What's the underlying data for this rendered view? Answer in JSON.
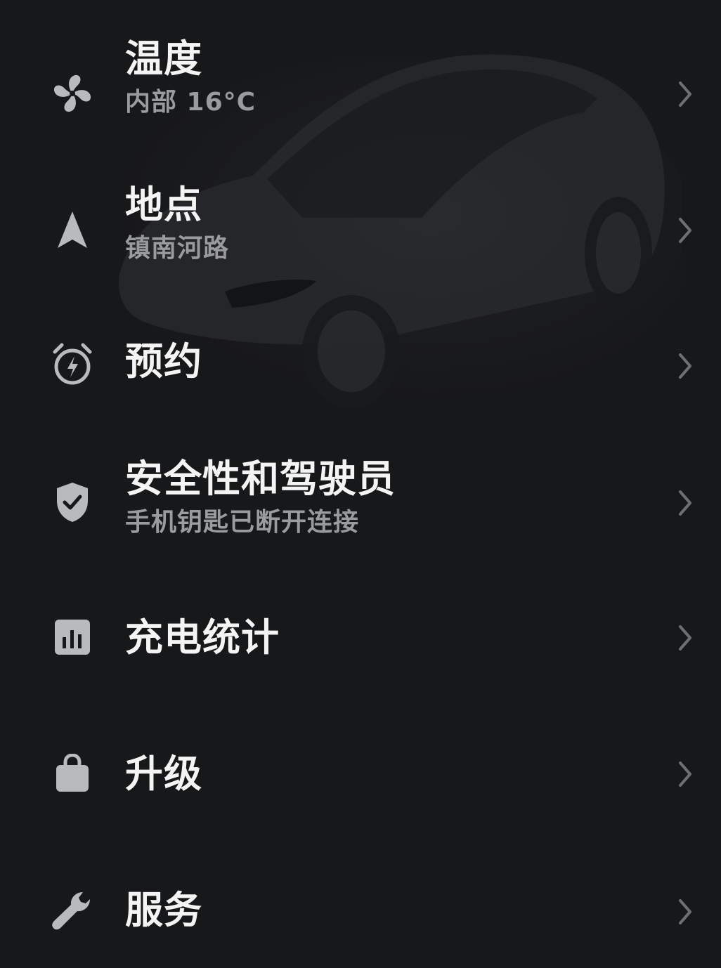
{
  "menu": {
    "items": [
      {
        "title": "温度",
        "subtitle": "内部 16°C",
        "icon": "fan-icon"
      },
      {
        "title": "地点",
        "subtitle": "镇南河路",
        "icon": "navigation-arrow-icon"
      },
      {
        "title": "预约",
        "subtitle": "",
        "icon": "alarm-clock-bolt-icon"
      },
      {
        "title": "安全性和驾驶员",
        "subtitle": "手机钥匙已断开连接",
        "icon": "shield-check-icon"
      },
      {
        "title": "充电统计",
        "subtitle": "",
        "icon": "bar-chart-icon"
      },
      {
        "title": "升级",
        "subtitle": "",
        "icon": "shopping-bag-icon"
      },
      {
        "title": "服务",
        "subtitle": "",
        "icon": "wrench-icon"
      }
    ]
  },
  "colors": {
    "background": "#17181a",
    "title": "#f4f4f4",
    "subtitle": "#9a9b9d",
    "icon": "#b9babc",
    "chevron": "#6e6f72"
  }
}
